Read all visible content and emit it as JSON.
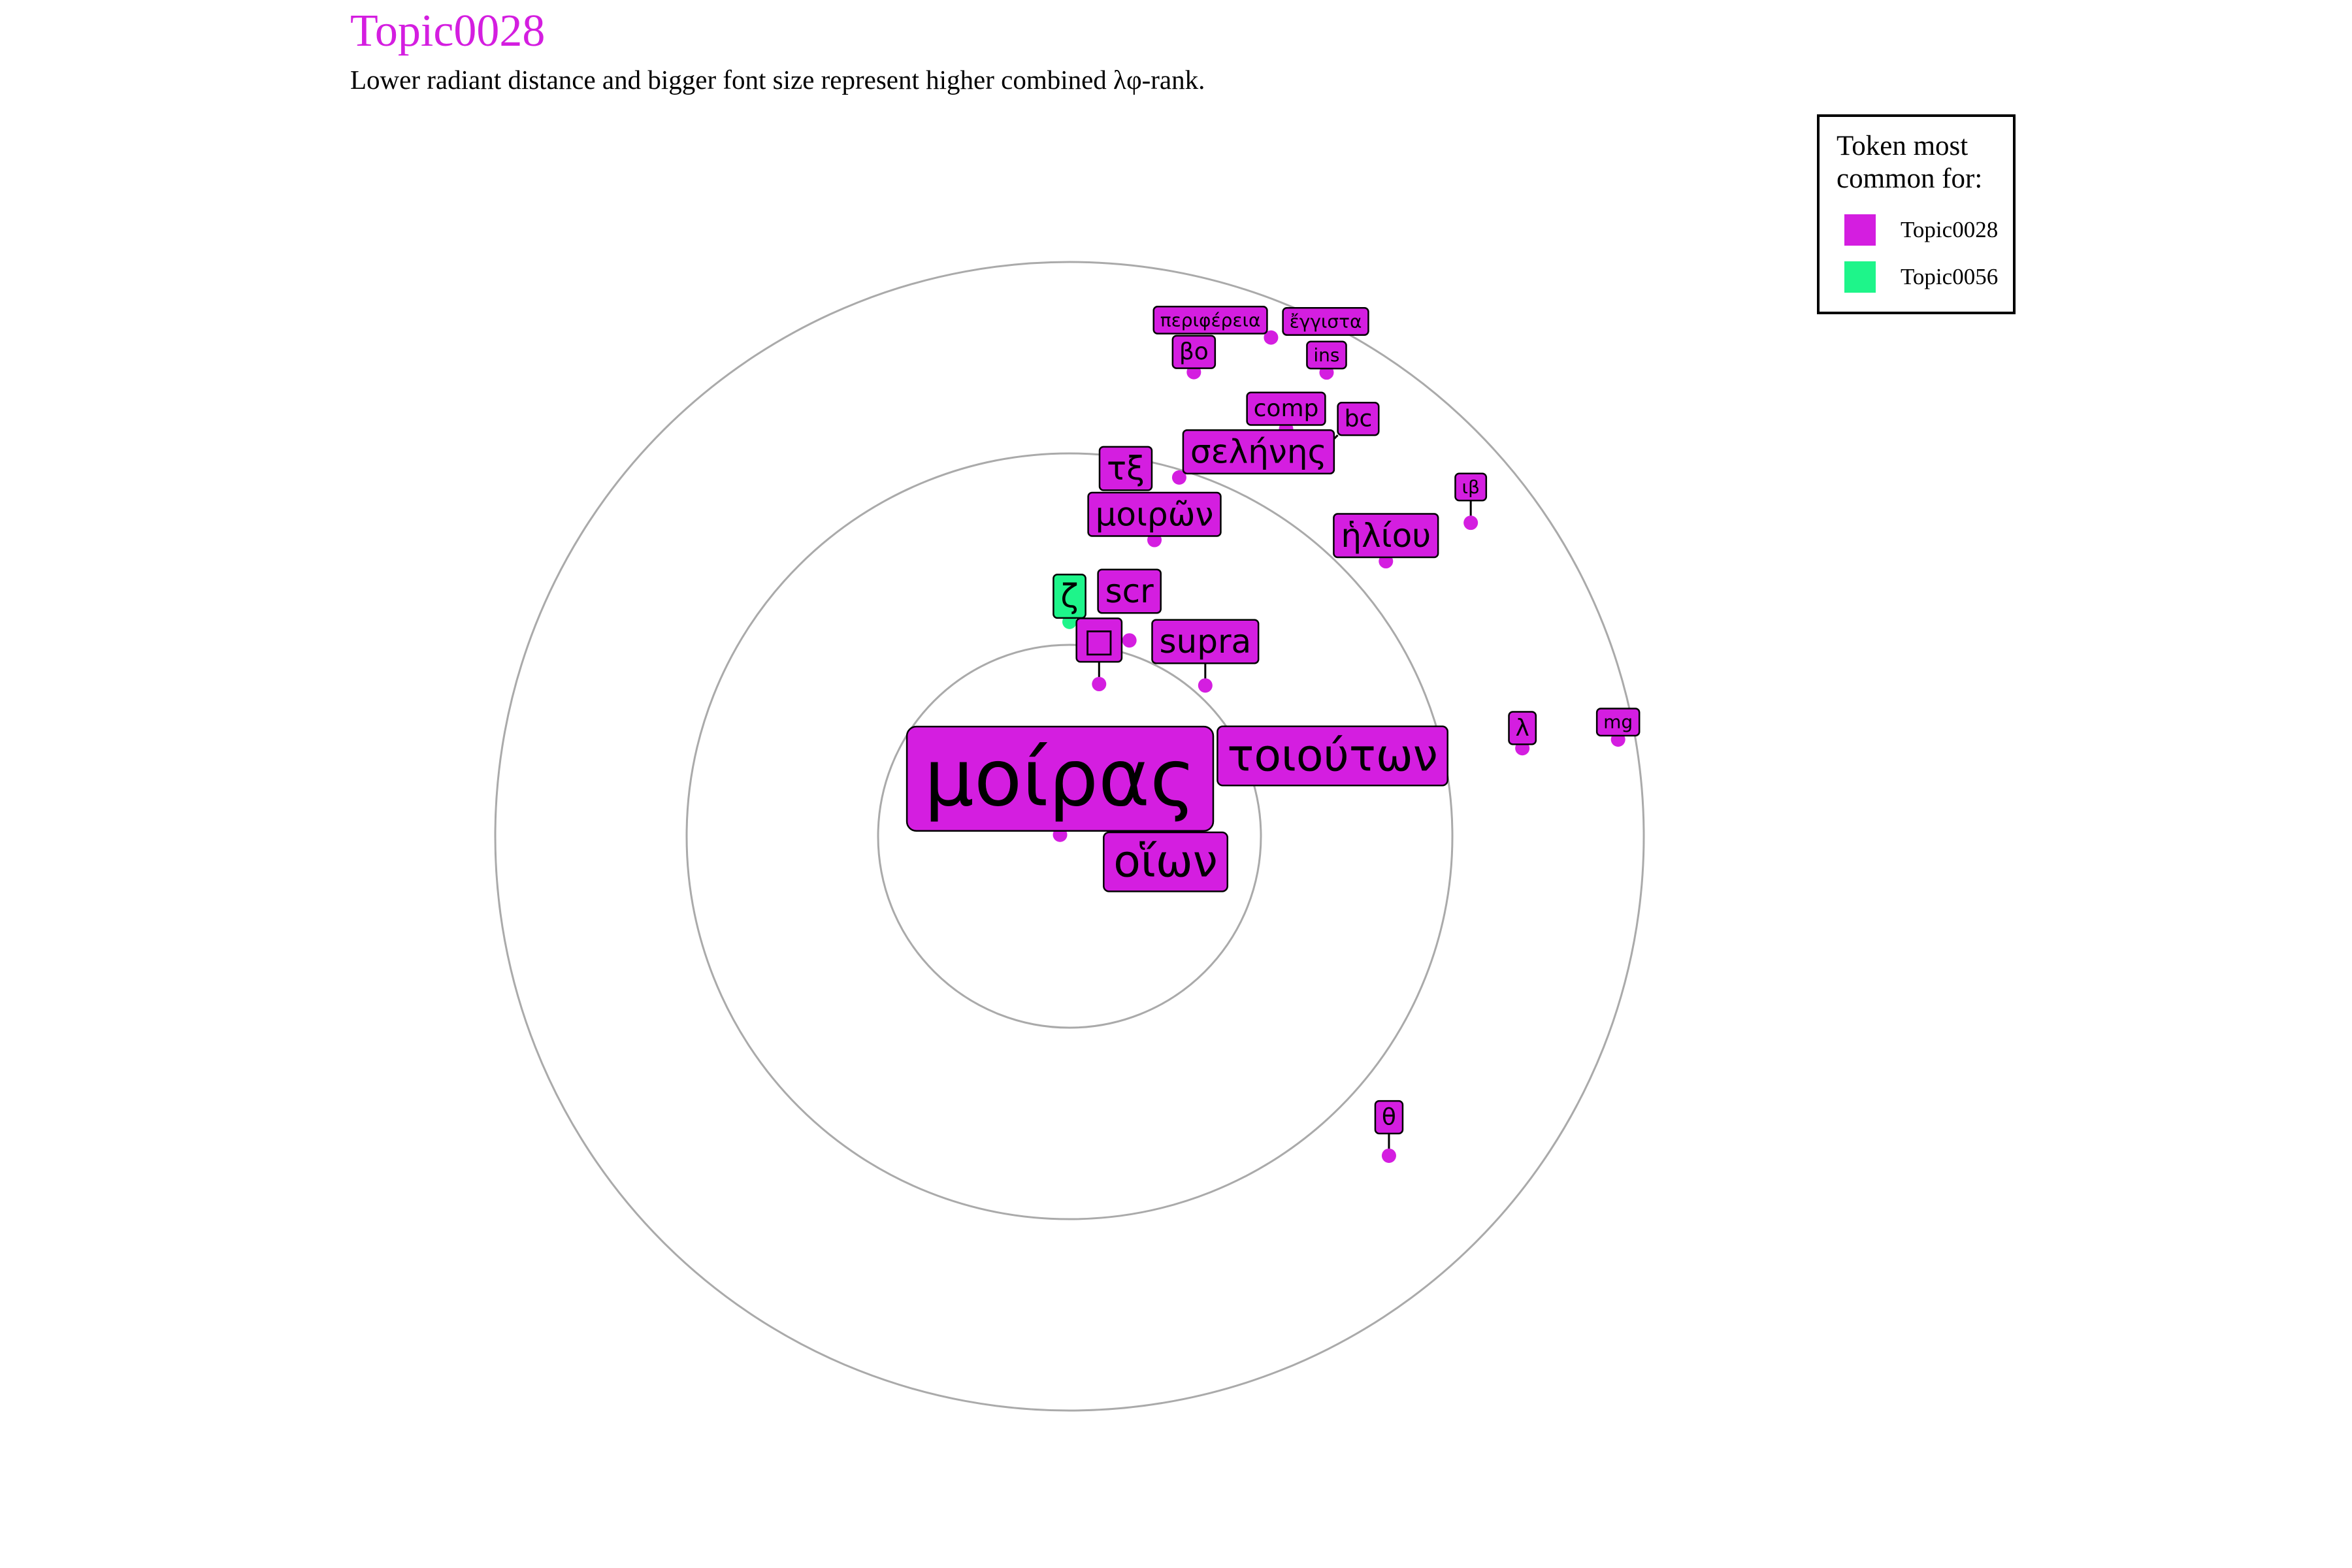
{
  "title": "Topic0028",
  "subtitle": "Lower radiant distance and bigger font size represent higher combined λφ-rank.",
  "colors": {
    "Topic0028": "#d41ee0",
    "Topic0056": "#1ef58a",
    "title": "#d41ee0",
    "ring": "#aaaaaa"
  },
  "legend": {
    "title": "Token most common for:",
    "items": [
      {
        "label": "Topic0028",
        "color": "#d41ee0"
      },
      {
        "label": "Topic0056",
        "color": "#1ef58a"
      }
    ]
  },
  "chart_data": {
    "type": "scatter",
    "subtype": "radial-text-network",
    "title": "Topic0028",
    "subtitle": "Lower radiant distance and bigger font size represent higher combined λφ-rank.",
    "rings": [
      1,
      2,
      3
    ],
    "grid": false,
    "legend_position": "top-right",
    "tokens": [
      {
        "label": "μοίρας",
        "topic": "Topic0028",
        "r": 0.05,
        "angle": 171,
        "size": 5,
        "leader": false
      },
      {
        "label": "οἵων",
        "topic": "Topic0028",
        "r": 0.3,
        "angle": 107,
        "size": 4,
        "leader": false
      },
      {
        "label": "τοιούτων",
        "topic": "Topic0028",
        "r": 0.74,
        "angle": 16,
        "size": 4,
        "leader": false
      },
      {
        "label": "supra",
        "topic": "Topic0028",
        "r": 1.06,
        "angle": 48,
        "size": 3,
        "leader": true
      },
      {
        "label": "□",
        "topic": "Topic0028",
        "r": 0.81,
        "angle": 79,
        "size": 3,
        "leader": true
      },
      {
        "label": "scr",
        "topic": "Topic0028",
        "r": 1.07,
        "angle": 73,
        "size": 3,
        "leader": false
      },
      {
        "label": "ζ",
        "topic": "Topic0056",
        "r": 1.12,
        "angle": 90,
        "size": 3,
        "leader": false
      },
      {
        "label": "μοιρῶν",
        "topic": "Topic0028",
        "r": 1.61,
        "angle": 74,
        "size": 3,
        "leader": false
      },
      {
        "label": "τξ",
        "topic": "Topic0028",
        "r": 1.69,
        "angle": 80,
        "size": 3,
        "leader": false
      },
      {
        "label": "σελήνης",
        "topic": "Topic0028",
        "r": 1.96,
        "angle": 73,
        "size": 3,
        "leader": false
      },
      {
        "label": "ἡλίου",
        "topic": "Topic0028",
        "r": 2.19,
        "angle": 41,
        "size": 3,
        "leader": false
      },
      {
        "label": "bc",
        "topic": "Topic0028",
        "r": 2.36,
        "angle": 57,
        "size": 2,
        "leader": true
      },
      {
        "label": "comp",
        "topic": "Topic0028",
        "r": 2.41,
        "angle": 62,
        "size": 2,
        "leader": false
      },
      {
        "label": "βo",
        "topic": "Topic0028",
        "r": 2.51,
        "angle": 75,
        "size": 2,
        "leader": false
      },
      {
        "label": "ins",
        "topic": "Topic0028",
        "r": 2.77,
        "angle": 61,
        "size": 1,
        "leader": false
      },
      {
        "label": "ἔγγιστα",
        "topic": "Topic0028",
        "r": 2.85,
        "angle": 62,
        "size": 1,
        "leader": false
      },
      {
        "label": "περιφέρεια",
        "topic": "Topic0028",
        "r": 2.81,
        "angle": 68,
        "size": 1,
        "leader": false
      },
      {
        "label": "ιβ",
        "topic": "Topic0028",
        "r": 2.66,
        "angle": 38,
        "size": 1,
        "leader": true
      },
      {
        "label": "λ",
        "topic": "Topic0028",
        "r": 2.41,
        "angle": 11,
        "size": 2,
        "leader": false
      },
      {
        "label": "θ",
        "topic": "Topic0028",
        "r": 2.36,
        "angle": -45,
        "size": 2,
        "leader": true
      },
      {
        "label": "mg",
        "topic": "Topic0028",
        "r": 2.91,
        "angle": 10,
        "size": 1,
        "leader": false
      }
    ]
  }
}
